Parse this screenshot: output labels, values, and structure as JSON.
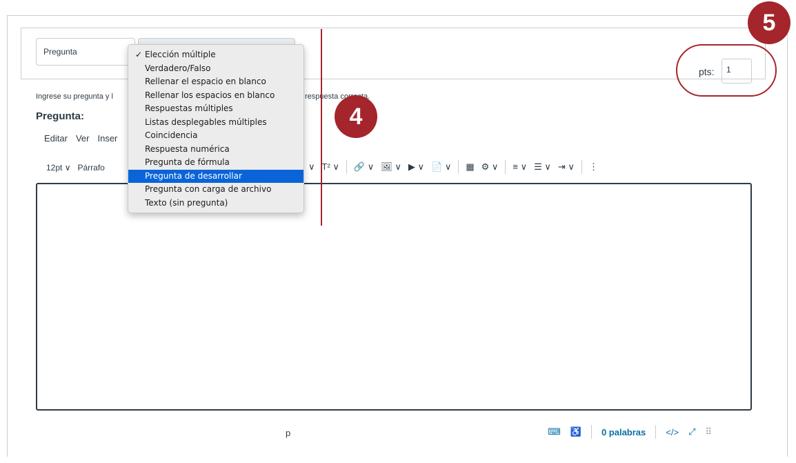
{
  "question_name": "Pregunta",
  "pts": {
    "label": "pts:",
    "value": "1"
  },
  "badges": {
    "step5": "5",
    "step4": "4"
  },
  "instructions": {
    "left": "Ingrese su pregunta y l",
    "right": "respuesta correcta."
  },
  "pregunta_label": "Pregunta:",
  "menubar": [
    "Editar",
    "Ver",
    "Inser"
  ],
  "toolbar": {
    "font_size": "12pt ∨",
    "paragraph": "Párrafo"
  },
  "toolbar_icons": [
    "∨",
    "T² ∨",
    "🔗 ∨",
    "🖼 ∨",
    "▶ ∨",
    "📄 ∨",
    "▦",
    "⚙ ∨",
    "≡ ∨",
    "☰ ∨",
    "⇥ ∨",
    "⋮"
  ],
  "dropdown": {
    "items": [
      {
        "label": "Elección múltiple",
        "checked": true,
        "selected": false
      },
      {
        "label": "Verdadero/Falso",
        "checked": false,
        "selected": false
      },
      {
        "label": "Rellenar el espacio en blanco",
        "checked": false,
        "selected": false
      },
      {
        "label": "Rellenar los espacios en blanco",
        "checked": false,
        "selected": false
      },
      {
        "label": "Respuestas múltiples",
        "checked": false,
        "selected": false
      },
      {
        "label": "Listas desplegables múltiples",
        "checked": false,
        "selected": false
      },
      {
        "label": "Coincidencia",
        "checked": false,
        "selected": false
      },
      {
        "label": "Respuesta numérica",
        "checked": false,
        "selected": false
      },
      {
        "label": "Pregunta de fórmula",
        "checked": false,
        "selected": false
      },
      {
        "label": "Pregunta de desarrollar",
        "checked": false,
        "selected": true
      },
      {
        "label": "Pregunta con carga de archivo",
        "checked": false,
        "selected": false
      },
      {
        "label": "Texto (sin pregunta)",
        "checked": false,
        "selected": false
      }
    ]
  },
  "statusbar": {
    "path": "p",
    "words": "0 palabras",
    "html_toggle": "</>"
  },
  "colors": {
    "accent": "#a4252b",
    "selection": "#0a64d8",
    "link": "#0770a3"
  }
}
